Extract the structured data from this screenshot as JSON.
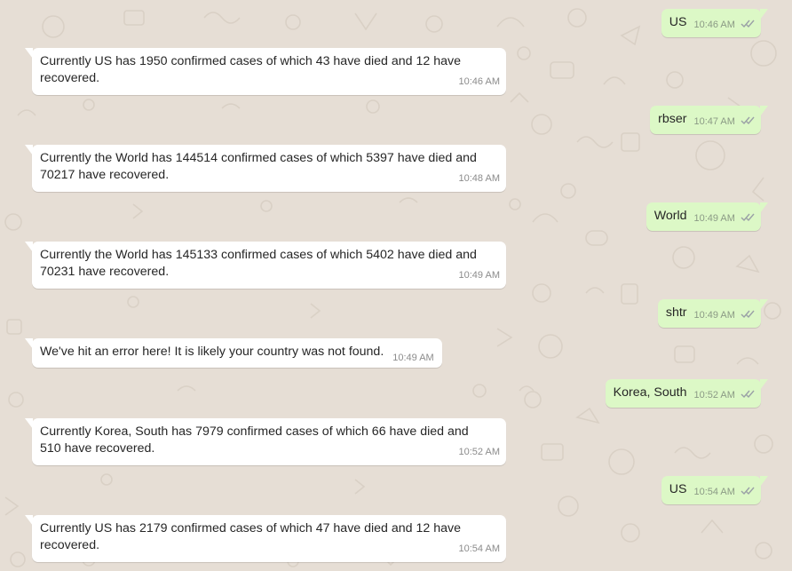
{
  "chat": {
    "colors": {
      "wallpaper": "#e6ded5",
      "incoming_bubble": "#ffffff",
      "outgoing_bubble": "#dcf8c6",
      "read_ticks": "#9aa0a6"
    },
    "messages": [
      {
        "direction": "out",
        "text": "US",
        "time": "10:46 AM",
        "status_icon": "double-check-icon"
      },
      {
        "direction": "in",
        "text": "Currently US has 1950 confirmed cases of which 43 have died and 12 have recovered.",
        "time": "10:46 AM"
      },
      {
        "direction": "out",
        "text": "rbser",
        "time": "10:47 AM",
        "status_icon": "double-check-icon"
      },
      {
        "direction": "in",
        "text": "Currently the World has 144514 confirmed cases of which 5397 have died and 70217 have recovered.",
        "time": "10:48 AM"
      },
      {
        "direction": "out",
        "text": "World",
        "time": "10:49 AM",
        "status_icon": "double-check-icon"
      },
      {
        "direction": "in",
        "text": "Currently the World has 145133 confirmed cases of which 5402 have died and 70231 have recovered.",
        "time": "10:49 AM"
      },
      {
        "direction": "out",
        "text": "shtr",
        "time": "10:49 AM",
        "status_icon": "double-check-icon"
      },
      {
        "direction": "in",
        "text": "We've hit an error here! It is likely your country was not found.",
        "time": "10:49 AM"
      },
      {
        "direction": "out",
        "text": "Korea, South",
        "time": "10:52 AM",
        "status_icon": "double-check-icon"
      },
      {
        "direction": "in",
        "text": "Currently Korea, South has 7979 confirmed cases of which 66 have died and 510 have recovered.",
        "time": "10:52 AM"
      },
      {
        "direction": "out",
        "text": "US",
        "time": "10:54 AM",
        "status_icon": "double-check-icon"
      },
      {
        "direction": "in",
        "text": "Currently US has 2179 confirmed cases of which 47 have died and 12 have recovered.",
        "time": "10:54 AM"
      }
    ]
  }
}
